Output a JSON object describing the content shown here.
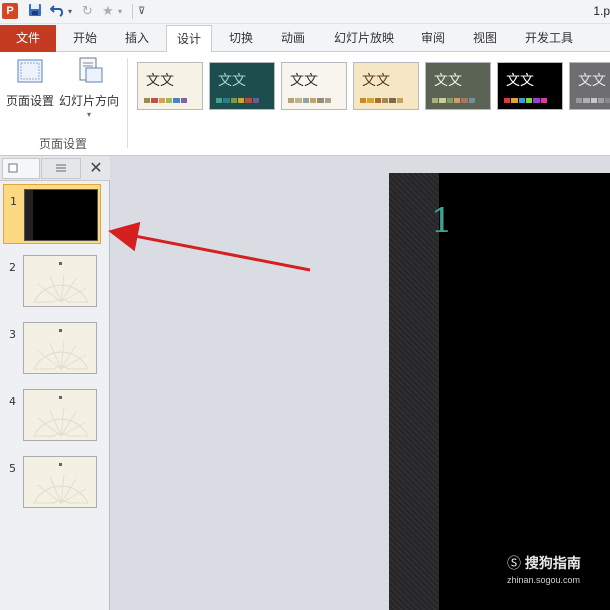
{
  "app": {
    "logo_letter": "P",
    "filename": "1.p"
  },
  "quick_access": {
    "save_icon": "save-icon",
    "undo_icon": "undo-icon",
    "redo_icon": "redo-icon",
    "star_icon": "star-icon",
    "customize_icon": "customize-icon"
  },
  "tabs": {
    "file": "文件",
    "items": [
      "开始",
      "插入",
      "设计",
      "切换",
      "动画",
      "幻灯片放映",
      "审阅",
      "视图",
      "开发工具"
    ],
    "active_index": 2
  },
  "ribbon": {
    "page_setup_label": "页面设置",
    "orientation_label": "幻灯片方向",
    "group_label": "页面设置",
    "theme_text": "文文",
    "themes": [
      {
        "bg": "#f6f3e6",
        "fg": "#333333",
        "colors": [
          "#9e8a4c",
          "#c0504d",
          "#d8a04d",
          "#9bbb59",
          "#4f81bd",
          "#8064a2"
        ]
      },
      {
        "bg": "#1e4d4d",
        "fg": "#9fd9d0",
        "colors": [
          "#3fa393",
          "#2f7c8c",
          "#7b9c3c",
          "#c9a33b",
          "#b24d3b",
          "#6a5a9a"
        ]
      },
      {
        "bg": "#f7f5ee",
        "fg": "#333333",
        "colors": [
          "#b5a27a",
          "#c0b28e",
          "#8fa3a8",
          "#c2a26e",
          "#9a8a7a",
          "#b0a090"
        ]
      },
      {
        "bg": "#f6e7c4",
        "fg": "#5a3a1a",
        "colors": [
          "#c7872a",
          "#d1a13c",
          "#b06a2e",
          "#9a8a5a",
          "#7a6a4a",
          "#c7a35a"
        ]
      },
      {
        "bg": "#5a6354",
        "fg": "#f0f0e8",
        "colors": [
          "#a6b07a",
          "#c7cf9a",
          "#8a9a6a",
          "#d0a060",
          "#a07a5a",
          "#7a8a9a"
        ]
      },
      {
        "bg": "#000000",
        "fg": "#ffffff",
        "colors": [
          "#d83b3b",
          "#e2a23a",
          "#3a9ad8",
          "#7ad83a",
          "#a03ad8",
          "#d83aa0"
        ]
      },
      {
        "bg": "#6e6e70",
        "fg": "#e8e8e8",
        "colors": [
          "#9a9a9a",
          "#b0b0b0",
          "#c8c8c8",
          "#a0a0a0",
          "#888888",
          "#bbbbbb"
        ]
      }
    ]
  },
  "panel": {
    "slides": [
      {
        "num": "1",
        "selected": true,
        "style": "dark"
      },
      {
        "num": "2",
        "selected": false,
        "style": "light"
      },
      {
        "num": "3",
        "selected": false,
        "style": "light"
      },
      {
        "num": "4",
        "selected": false,
        "style": "light"
      },
      {
        "num": "5",
        "selected": false,
        "style": "light"
      }
    ]
  },
  "slide": {
    "title": "1"
  },
  "watermark": {
    "main": "搜狗指南",
    "sub": "zhinan.sogou.com"
  },
  "colors": {
    "accent": "#c43b22",
    "arrow": "#d61f1f",
    "slide_title": "#3fa393"
  }
}
